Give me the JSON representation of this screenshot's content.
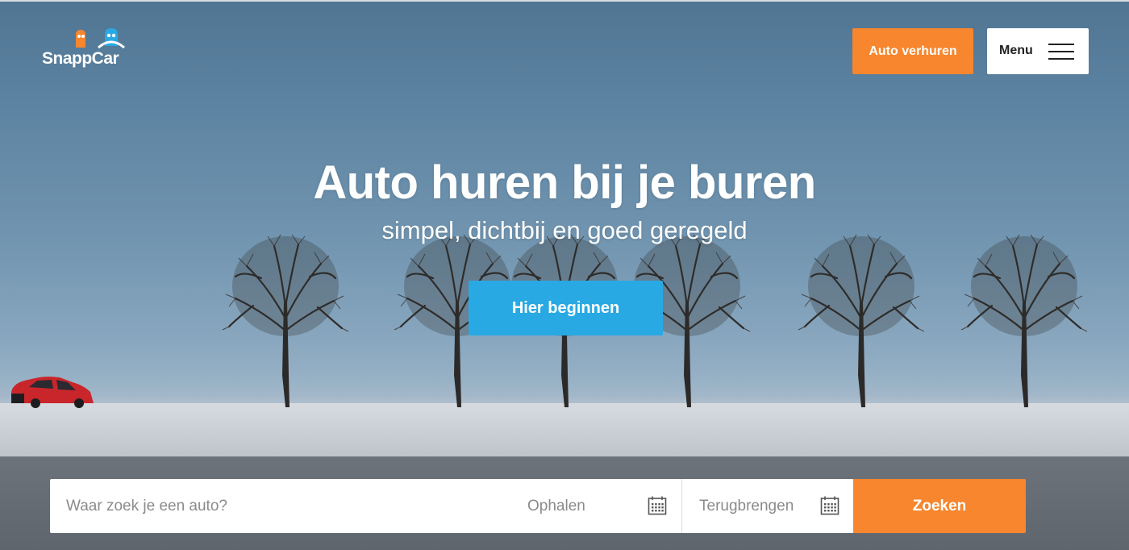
{
  "brand": {
    "name": "SnappCar",
    "colors": {
      "primary_orange": "#f7862e",
      "accent_blue": "#29a9e3",
      "white": "#ffffff"
    }
  },
  "header": {
    "rent_out_label": "Auto verhuren",
    "menu_label": "Menu",
    "menu_icon": "hamburger-icon"
  },
  "hero": {
    "title": "Auto huren bij je buren",
    "subtitle": "simpel, dichtbij en goed geregeld",
    "cta_label": "Hier beginnen",
    "background": "winter-landscape-trees-red-car"
  },
  "search": {
    "location_placeholder": "Waar zoek je een auto?",
    "location_value": "",
    "geolocate_icon": "location-arrow-icon",
    "pickup_placeholder": "Ophalen",
    "return_placeholder": "Terugbrengen",
    "calendar_icon": "calendar-icon",
    "submit_label": "Zoeken"
  }
}
